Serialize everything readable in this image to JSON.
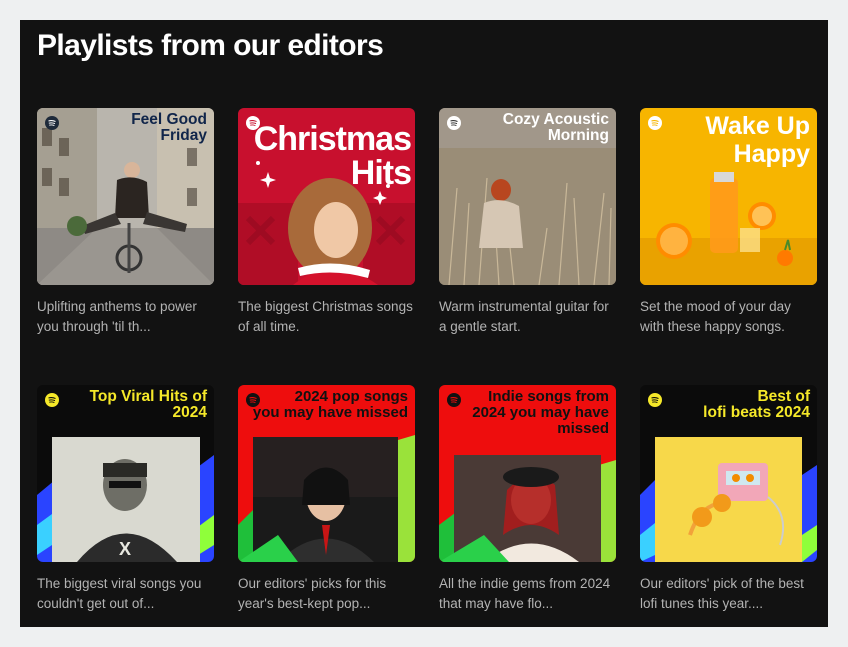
{
  "section": {
    "title": "Playlists from our editors"
  },
  "playlists": [
    {
      "title_lines": [
        "Feel Good",
        "Friday"
      ],
      "description": "Uplifting anthems to power you through 'til th..."
    },
    {
      "title_lines": [
        "Christmas",
        "Hits"
      ],
      "description": "The biggest Christmas songs of all time."
    },
    {
      "title_lines": [
        "Cozy Acoustic",
        "Morning"
      ],
      "description": "Warm instrumental guitar for a gentle start."
    },
    {
      "title_lines": [
        "Wake Up",
        "Happy"
      ],
      "description": "Set the mood of your day with these happy songs."
    },
    {
      "title_lines": [
        "Top Viral Hits of",
        "2024"
      ],
      "description": "The biggest viral songs you couldn't get out of..."
    },
    {
      "title_lines": [
        "2024 pop songs",
        "you may have missed"
      ],
      "description": "Our editors' picks for this year's best-kept pop..."
    },
    {
      "title_lines": [
        "Indie songs from",
        "2024 you may have",
        "missed"
      ],
      "description": "All the indie gems from 2024 that may have flo..."
    },
    {
      "title_lines": [
        "Best of",
        "lofi beats 2024"
      ],
      "description": "Our editors' pick of the best lofi tunes this year...."
    }
  ],
  "colors": {
    "panel_bg": "#121212",
    "text_primary": "#ffffff",
    "text_secondary": "#b3b3b3",
    "christmas_red": "#c8102e",
    "wake_up_yellow": "#f7b500",
    "viral_yellow": "#f5e829",
    "pop_red": "#ee0d0d"
  },
  "icons": [
    "spotify-logo-icon"
  ]
}
